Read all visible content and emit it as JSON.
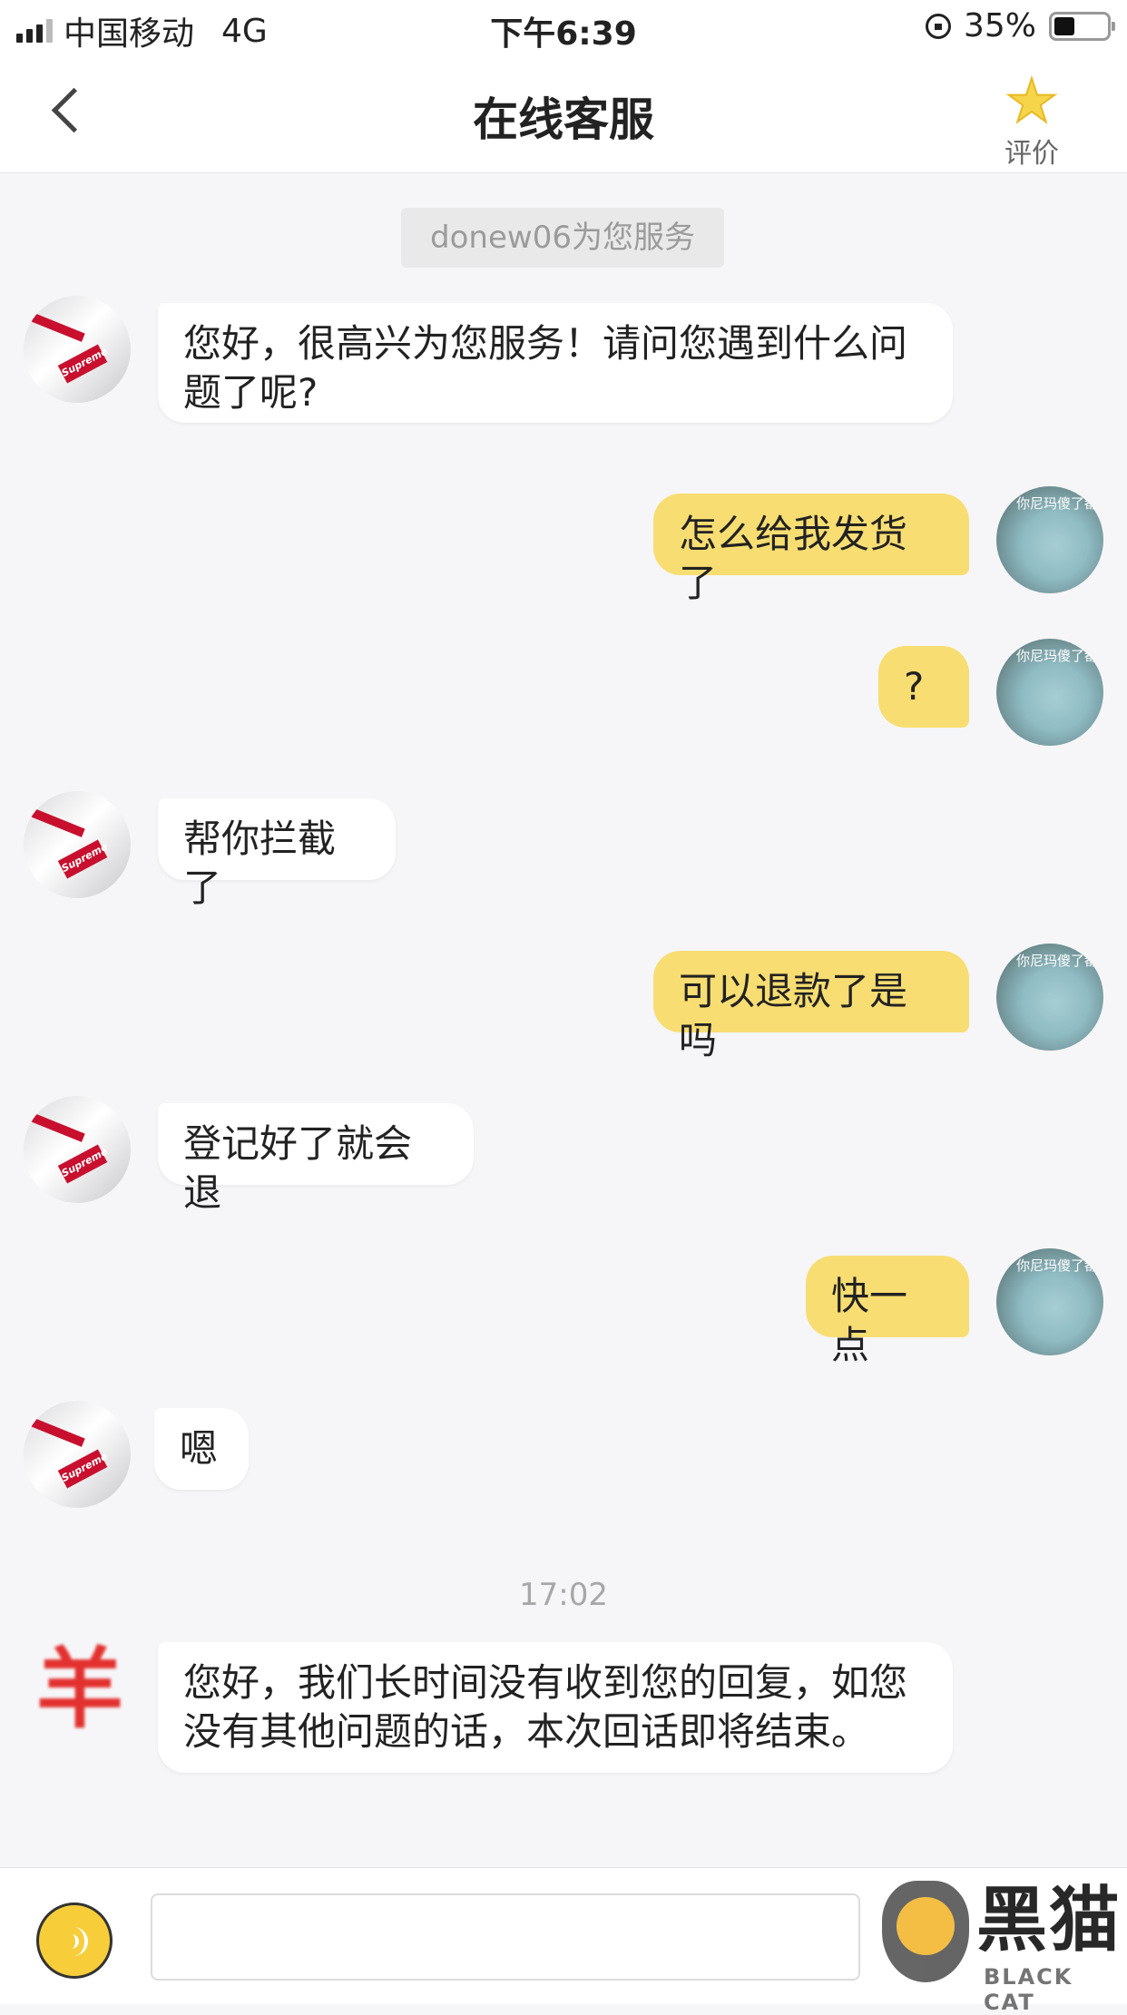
{
  "status_bar": {
    "carrier": "中国移动",
    "network": "4G",
    "time": "下午6:39",
    "battery": "35%",
    "battery_level": 0.35
  },
  "nav": {
    "title": "在线客服",
    "rate_label": "评价"
  },
  "service_tag": "donew06为您服务",
  "user_avatar_text": "你尼玛傻了都",
  "messages": [
    {
      "from": "agent",
      "text": "您好，很高兴为您服务！请问您遇到什么问题了呢?"
    },
    {
      "from": "user",
      "text": "怎么给我发货了"
    },
    {
      "from": "user",
      "text": "?"
    },
    {
      "from": "agent",
      "text": "帮你拦截了"
    },
    {
      "from": "user",
      "text": "可以退款了是吗"
    },
    {
      "from": "agent",
      "text": "登记好了就会退"
    },
    {
      "from": "user",
      "text": "快一点"
    },
    {
      "from": "agent",
      "text": "嗯"
    },
    {
      "from": "bot",
      "text": "您好，我们长时间没有收到您的回复，如您没有其他问题的话，本次回话即将结束。"
    }
  ],
  "timestamp": "17:02",
  "bot_avatar_glyph": "羊",
  "watermark": {
    "cn": "黑猫",
    "en": "BLACK CAT"
  }
}
